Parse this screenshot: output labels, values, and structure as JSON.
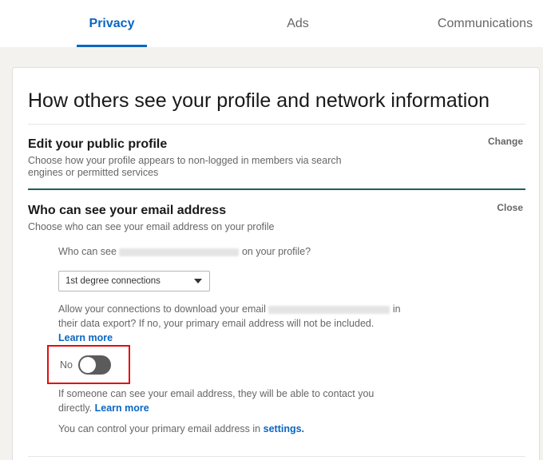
{
  "tabs": {
    "privacy": "Privacy",
    "ads": "Ads",
    "communications": "Communications"
  },
  "page": {
    "title": "How others see your profile and network information"
  },
  "public_profile": {
    "title": "Edit your public profile",
    "description": "Choose how your profile appears to non-logged in members via search engines or permitted services",
    "action": "Change"
  },
  "email_section": {
    "title": "Who can see your email address",
    "description": "Choose who can see your email address on your profile",
    "action": "Close",
    "question_prefix": "Who can see",
    "question_suffix": "on your profile?",
    "select_value": "1st degree connections",
    "export_prefix": "Allow your connections to download your email",
    "export_suffix": "in",
    "export_line2": "their data export? If no, your primary email address will not be included.",
    "learn_more": "Learn more",
    "toggle_label": "No",
    "toggle_on": false,
    "contact_text": "If someone can see your email address, they will be able to contact you directly.",
    "contact_learn_more": "Learn more",
    "control_text": "You can control your primary email address in",
    "settings_link": "settings."
  },
  "colors": {
    "accent": "#0a66c2",
    "highlight_box": "#e30d0d",
    "section_divider": "#1d5f5e",
    "toggle_off": "#5b5b5b"
  }
}
